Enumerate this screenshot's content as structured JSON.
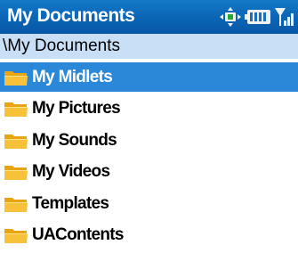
{
  "window": {
    "title": "My Documents"
  },
  "status_icons": [
    "connectivity-icon",
    "battery-icon",
    "signal-icon"
  ],
  "path_bar": {
    "path": "\\My Documents"
  },
  "folders": [
    {
      "label": "My Midlets",
      "selected": true
    },
    {
      "label": "My Pictures",
      "selected": false
    },
    {
      "label": "My Sounds",
      "selected": false
    },
    {
      "label": "My Videos",
      "selected": false
    },
    {
      "label": "Templates",
      "selected": false
    },
    {
      "label": "UAContents",
      "selected": false
    }
  ],
  "colors": {
    "title_bar": "#0a64b4",
    "path_bar": "#c9dff6",
    "selection": "#2b88d8",
    "folder": "#f5b922"
  }
}
